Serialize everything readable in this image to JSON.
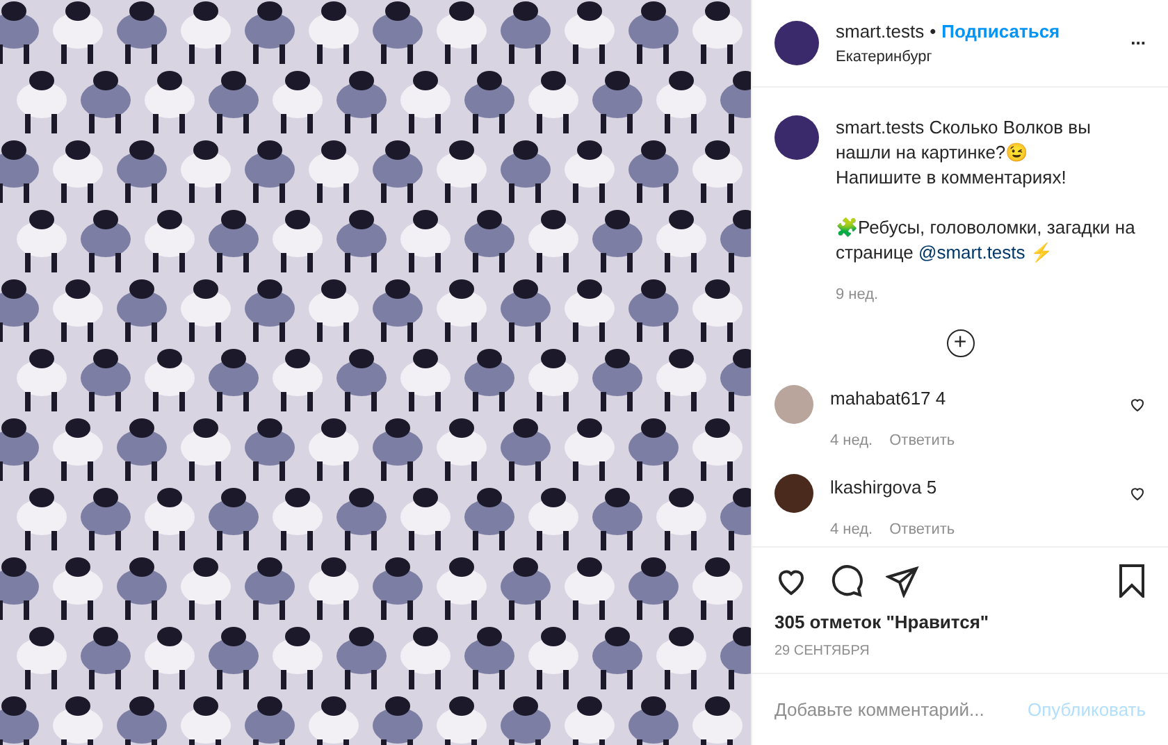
{
  "post": {
    "author": "smart.tests",
    "separator": "•",
    "follow": "Подписаться",
    "location": "Екатеринбург",
    "more": "..."
  },
  "caption": {
    "author": "smart.tests",
    "first": "Сколько Волков вы нашли на картинке?😉",
    "second": "Напишите в комментариях!",
    "third": "🧩Ребусы, головоломки, загадки на странице",
    "link": "@smart.tests",
    "after": "⚡",
    "time": "9 нед."
  },
  "load_more": "+",
  "comments": [
    {
      "author": "mahabat617",
      "text": "4",
      "time": "4 нед.",
      "reply": "Ответить",
      "liked": false
    },
    {
      "author": "lkashirgova",
      "text": "5",
      "time": "4 нед.",
      "reply": "Ответить",
      "liked": false
    }
  ],
  "likes": "305 отметок \"Нравится\"",
  "date": "29 СЕНТЯБРЯ",
  "comment_field": {
    "placeholder": "Добавьте комментарий..."
  },
  "publish": "Опубликовать"
}
